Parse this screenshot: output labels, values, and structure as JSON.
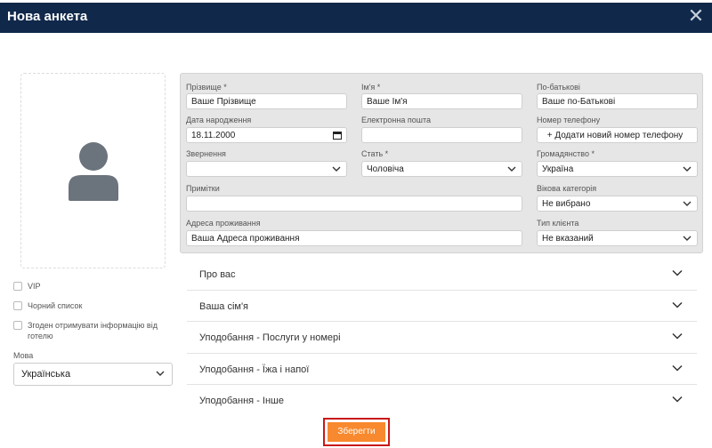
{
  "window": {
    "title": "Нова анкета",
    "close_symbol": "✕"
  },
  "checkboxes": [
    {
      "label": "VIP",
      "checked": false
    },
    {
      "label": "Чорний список",
      "checked": false
    },
    {
      "label": "Згоден отримувати інформацію від готелю",
      "checked": false
    }
  ],
  "language": {
    "label": "Мова",
    "value": "Українська"
  },
  "form": {
    "surname": {
      "label": "Прізвище *",
      "value": "Ваше Прізвище"
    },
    "name": {
      "label": "Ім'я *",
      "value": "Ваше Ім'я"
    },
    "patronymic": {
      "label": "По-батькові",
      "value": "Ваше по-Батькові"
    },
    "birthdate": {
      "label": "Дата народження",
      "value": "18.11.2000"
    },
    "email": {
      "label": "Електронна пошта",
      "value": ""
    },
    "phone": {
      "label": "Номер телефону",
      "button": "+ Додати новий номер телефону"
    },
    "salutation": {
      "label": "Звернення",
      "value": ""
    },
    "gender": {
      "label": "Стать *",
      "value": "Чоловіча"
    },
    "citizenship": {
      "label": "Громадянство *",
      "value": "Україна"
    },
    "notes": {
      "label": "Примітки",
      "value": ""
    },
    "age_category": {
      "label": "Вікова категорія",
      "value": "Не вибрано"
    },
    "address": {
      "label": "Адреса проживання",
      "value": "Ваша Адреса проживання"
    },
    "client_type": {
      "label": "Тип клієнта",
      "value": "Не вказаний"
    }
  },
  "sections": [
    "Про вас",
    "Ваша сім'я",
    "Уподобання - Послуги у номері",
    "Уподобання - Їжа і напої",
    "Уподобання - Інше"
  ],
  "save_label": "Зберегти",
  "colors": {
    "header": "#10284a",
    "save": "#f8892e",
    "highlight": "#c91818"
  },
  "icons": {
    "avatar": "avatar-icon",
    "close": "close-icon",
    "chevron": "chevron-down-icon",
    "calendar": "calendar-icon"
  }
}
